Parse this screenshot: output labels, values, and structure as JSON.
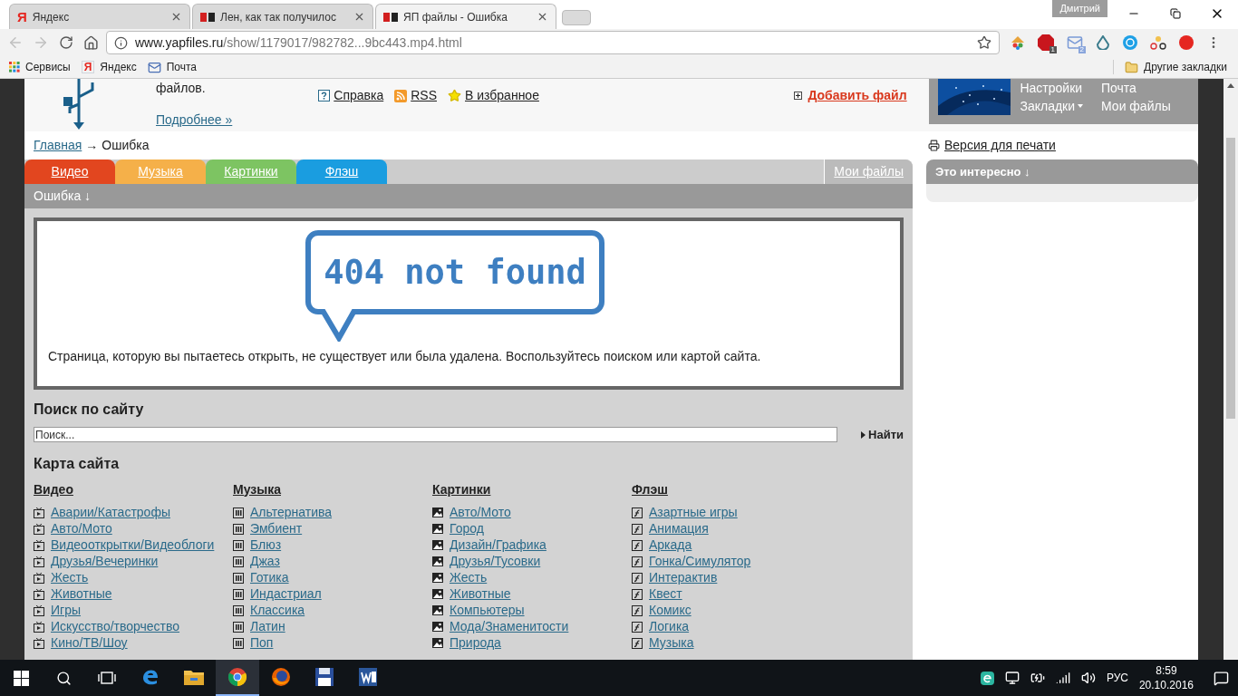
{
  "browser": {
    "tabs": [
      {
        "title": "Яндекс",
        "kind": "yandex",
        "glyph": "Я",
        "selected": false
      },
      {
        "title": "Лен, как так получилос",
        "kind": "yap",
        "selected": false
      },
      {
        "title": "ЯП файлы - Ошибка",
        "kind": "yap",
        "selected": true
      }
    ],
    "user": "Дмитрий",
    "url": {
      "host": "www.yapfiles.ru",
      "path": "/show/1179017/982782...9bc443.mp4.html"
    },
    "bookmarks": [
      {
        "label": "Сервисы",
        "kind": "apps"
      },
      {
        "label": "Яндекс",
        "kind": "yandex",
        "glyph": "Я"
      },
      {
        "label": "Почта",
        "kind": "mail"
      }
    ],
    "other_bookmarks": "Другие закладки",
    "extension_badges": [
      "1",
      "2"
    ]
  },
  "header": {
    "intro_tail": "файлов.",
    "more_link": "Подробнее »",
    "links": [
      {
        "label": "Справка",
        "kind": "help"
      },
      {
        "label": "RSS",
        "kind": "rss"
      },
      {
        "label": "В избранное",
        "kind": "star"
      }
    ],
    "add_file": "Добавить файл",
    "user_menu": [
      {
        "label": "Настройки",
        "dropdown": false
      },
      {
        "label": "Почта",
        "dropdown": false
      },
      {
        "label": "Закладки",
        "dropdown": true
      },
      {
        "label": "Мои файлы",
        "dropdown": false
      }
    ]
  },
  "breadcrumb": {
    "home": "Главная",
    "separator": "→",
    "current": "Ошибка"
  },
  "category_tabs": [
    {
      "label": "Видео",
      "color": "#e2461f"
    },
    {
      "label": "Музыка",
      "color": "#f5b049"
    },
    {
      "label": "Картинки",
      "color": "#7dc462"
    },
    {
      "label": "Флэш",
      "color": "#1a9de0"
    }
  ],
  "my_files": "Мои файлы",
  "section_title": "Ошибка ↓",
  "error": {
    "code_text": "404 not found",
    "message": "Страница, которую вы пытаетесь открыть, не существует или была удалена. Воспользуйтесь поиском или картой сайта."
  },
  "search": {
    "title": "Поиск по сайту",
    "placeholder": "Поиск...",
    "button": "Найти"
  },
  "sitemap": {
    "title": "Карта сайта",
    "columns": [
      {
        "heading": "Видео",
        "kind": "video",
        "items": [
          "Аварии/Катастрофы",
          "Авто/Мото",
          "Видеооткрытки/Видеоблоги",
          "Друзья/Вечеринки",
          "Жесть",
          "Животные",
          "Игры",
          "Искусство/творчество",
          "Кино/ТВ/Шоу"
        ]
      },
      {
        "heading": "Музыка",
        "kind": "music",
        "items": [
          "Альтернатива",
          "Эмбиент",
          "Блюз",
          "Джаз",
          "Готика",
          "Индастриал",
          "Классика",
          "Латин",
          "Поп"
        ]
      },
      {
        "heading": "Картинки",
        "kind": "picture",
        "items": [
          "Авто/Мото",
          "Город",
          "Дизайн/Графика",
          "Друзья/Тусовки",
          "Жесть",
          "Животные",
          "Компьютеры",
          "Мода/Знаменитости",
          "Природа"
        ]
      },
      {
        "heading": "Флэш",
        "kind": "flash",
        "items": [
          "Азартные игры",
          "Анимация",
          "Аркада",
          "Гонка/Симулятор",
          "Интерактив",
          "Квест",
          "Комикс",
          "Логика",
          "Музыка"
        ]
      }
    ]
  },
  "sidebar": {
    "print_link": "Версия для печати",
    "interesting_title": "Это интересно ↓"
  },
  "taskbar": {
    "apps": [
      {
        "kind": "edge",
        "selected": false
      },
      {
        "kind": "explorer",
        "selected": false
      },
      {
        "kind": "chrome",
        "selected": true
      },
      {
        "kind": "firefox",
        "selected": false
      },
      {
        "kind": "floppy",
        "selected": false
      },
      {
        "kind": "word",
        "selected": false
      }
    ],
    "lang": "РУС",
    "time": "8:59",
    "date": "20.10.2016"
  }
}
